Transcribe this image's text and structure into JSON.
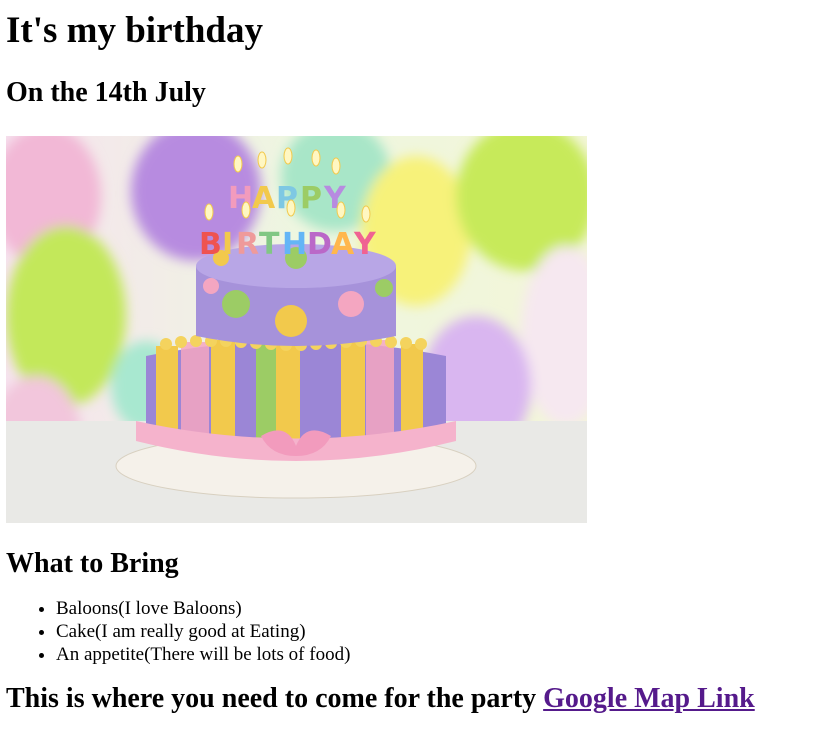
{
  "page": {
    "title": "It's my birthday",
    "subtitle": "On the 14th July",
    "image_alt": "Birthday cake with Happy Birthday candles in front of colourful balloons",
    "bring_heading": "What to Bring",
    "bring_items": [
      "Baloons(I love Baloons)",
      "Cake(I am really good at Eating)",
      "An appetite(There will be lots of food)"
    ],
    "party_text": "This is where you need to come for the party",
    "map_link_label": "Google Map Link"
  },
  "colors": {
    "link_visited": "#551a8b",
    "cake_purple": "#9b86d6",
    "cake_yellow": "#f2c94c",
    "cake_pink": "#f4a6c1",
    "cake_green": "#9ccc65"
  }
}
